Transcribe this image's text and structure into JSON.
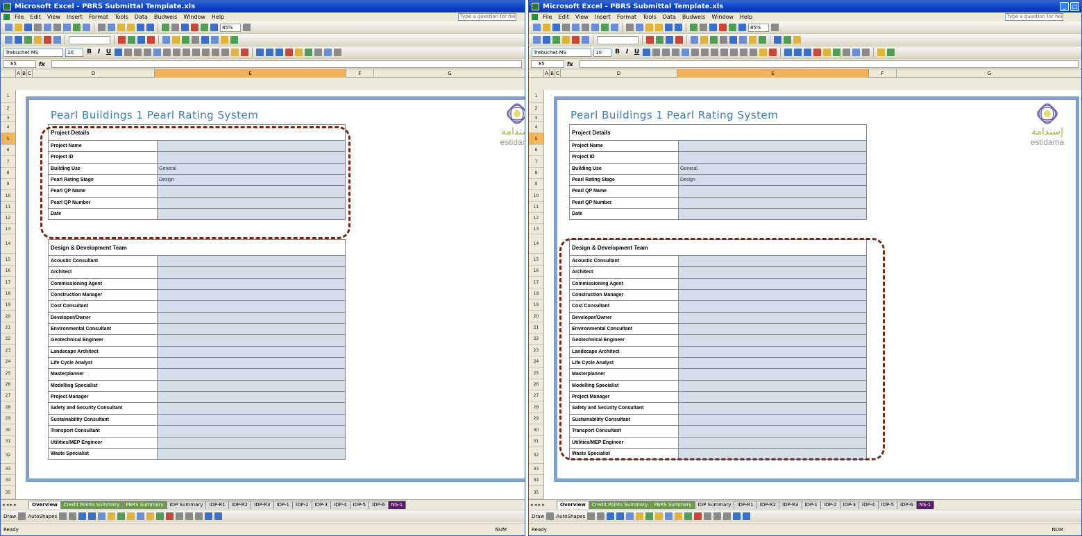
{
  "window": {
    "title": "Microsoft Excel - PBRS Submittal Template.xls",
    "menu": [
      "File",
      "Edit",
      "View",
      "Insert",
      "Format",
      "Tools",
      "Data",
      "Budweis",
      "Window",
      "Help"
    ],
    "ask_placeholder": "Type a question for help",
    "zoom": "85%",
    "font_name": "Trebuchet MS",
    "font_size": "10",
    "name_box": "E5",
    "fx": "fx"
  },
  "sheet": {
    "title": "Pearl Buildings 1 Pearl Rating System",
    "columns": [
      "A",
      "B",
      "C",
      "D",
      "E",
      "F",
      "G"
    ],
    "rows": [
      "1",
      "2",
      "3",
      "4",
      "5",
      "6",
      "7",
      "8",
      "9",
      "10",
      "11",
      "12",
      "13",
      "14",
      "15",
      "16",
      "17",
      "18",
      "19",
      "20",
      "21",
      "22",
      "23",
      "24",
      "25",
      "26",
      "27",
      "28",
      "29",
      "30",
      "31",
      "32",
      "33",
      "34",
      "35"
    ],
    "logo": {
      "arabic": "إستدامة",
      "latin": "estidama"
    },
    "project_details": {
      "header": "Project Details",
      "rows": [
        {
          "label": "Project Name",
          "value": ""
        },
        {
          "label": "Project ID",
          "value": ""
        },
        {
          "label": "Building Use",
          "value": "General"
        },
        {
          "label": "Pearl Rating Stage",
          "value": "Design"
        },
        {
          "label": "Pearl QP Name",
          "value": ""
        },
        {
          "label": "Pearl QP Number",
          "value": ""
        },
        {
          "label": "Date",
          "value": ""
        }
      ]
    },
    "team": {
      "header": "Design & Development Team",
      "rows": [
        "Acoustic Consultant",
        "Architect",
        "Commissioning Agent",
        "Construction Manager",
        "Cost Consultant",
        "Developer/Owner",
        "Environmental Consultant",
        "Geotechnical Engineer",
        "Landscape Architect",
        "Life Cycle Analyst",
        "Masterplanner",
        "Modelling Specialist",
        "Project Manager",
        "Safety and Security Consultant",
        "Sustainability Consultant",
        "Transport Consultant",
        "Utilities/MEP Engineer",
        "Waste Specialist"
      ]
    }
  },
  "tabs": [
    "Overview",
    "Credit Points Summary",
    "PBRS Summary",
    "IDP Summary",
    "IDP-R1",
    "IDP-R2",
    "IDP-R3",
    "IDP-1",
    "IDP-2",
    "IDP-3",
    "IDP-4",
    "IDP-5",
    "IDP-6",
    "NS-1"
  ],
  "drawing": {
    "draw_label": "Draw",
    "autoshapes_label": "AutoShapes"
  },
  "status": {
    "left": "Ready",
    "right": "NUM"
  },
  "colors": {
    "highlight": "#7a2410",
    "value_fill": "#d4dcea",
    "frame": "#7fa2cc",
    "title": "#3a7bb4"
  }
}
